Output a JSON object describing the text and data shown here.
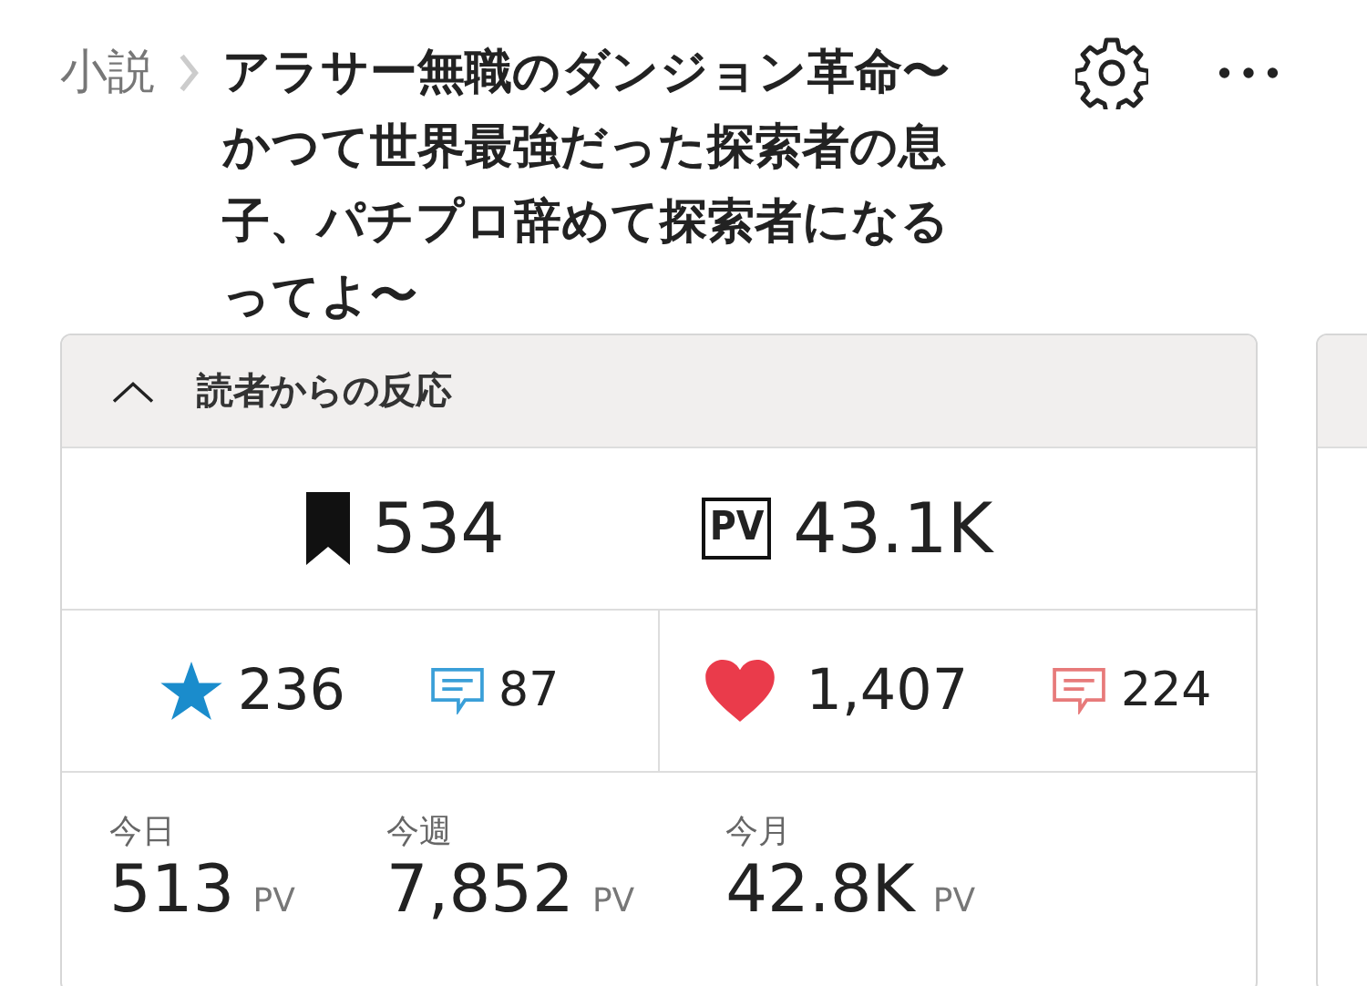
{
  "breadcrumb": {
    "category": "小説"
  },
  "title": "アラサー無職のダンジョン革命〜かつて世界最強だった探索者の息子、パチプロ辞めて探索者になるってよ〜",
  "card": {
    "expanded": true,
    "title": "読者からの反応",
    "totals": [
      {
        "kind": "bookmark",
        "value": "534"
      },
      {
        "kind": "pv",
        "badge": "PV",
        "value": "43.1K"
      }
    ],
    "reactions": [
      {
        "main": {
          "kind": "star",
          "value": "236"
        },
        "comments": {
          "color": "#3a9fd8",
          "value": "87"
        }
      },
      {
        "main": {
          "kind": "heart",
          "value": "1,407"
        },
        "comments": {
          "color": "#e77a7a",
          "value": "224"
        }
      }
    ],
    "periods": [
      {
        "label": "今日",
        "value": "513",
        "unit": "PV"
      },
      {
        "label": "今週",
        "value": "7,852",
        "unit": "PV"
      },
      {
        "label": "今月",
        "value": "42.8K",
        "unit": "PV"
      }
    ]
  }
}
